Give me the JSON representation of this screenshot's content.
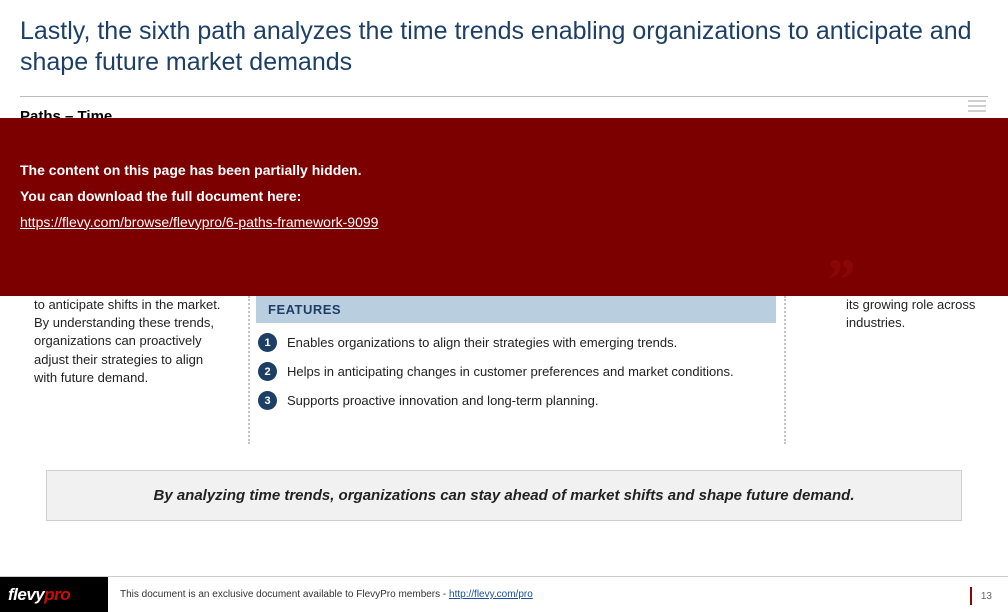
{
  "title": "Lastly, the sixth path analyzes the time trends enabling organizations to anticipate and shape future market demands",
  "subhead": "Paths – Time",
  "overlay": {
    "line1": "The content on this page has been partially hidden.",
    "line2": "You can download the full document here:",
    "link_text": "https://flevy.com/browse/flevypro/6-paths-framework-9099",
    "link_href": "https://flevy.com/browse/flevypro/6-paths-framework-9099"
  },
  "left_col": "to anticipate shifts in the market. By understanding these trends, organizations can proactively adjust their strategies to align with future demand.",
  "right_col": "its growing role across industries.",
  "features": {
    "heading": "FEATURES",
    "items": [
      "Enables organizations to align their strategies with emerging trends.",
      "Helps in anticipating changes in customer preferences and market conditions.",
      "Supports proactive innovation and long-term planning."
    ]
  },
  "callout": "By analyzing time trends, organizations can stay ahead of market shifts and shape future demand.",
  "footer": {
    "logo_main": "flevy",
    "logo_sub": "pro",
    "text_prefix": "This document is an exclusive document available to FlevyPro members - ",
    "link_text": "http://flevy.com/pro",
    "link_href": "http://flevy.com/pro"
  },
  "page_number": "13"
}
